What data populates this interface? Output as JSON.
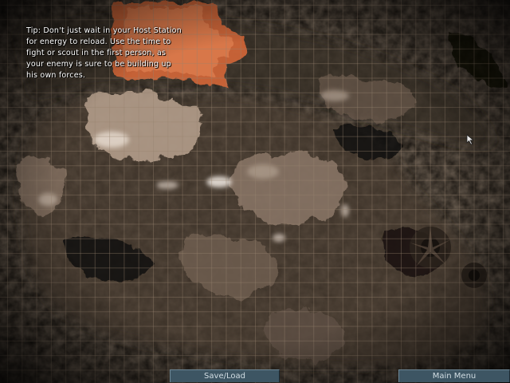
{
  "tip": {
    "lines": [
      "Tip:  Don't just wait in your Host Station",
      "for energy to reload. Use the time to",
      "fight or scout in the first person, as",
      "your enemy is sure to be building up",
      "his own forces."
    ]
  },
  "buttons": {
    "save_load": "Save/Load",
    "main_menu": "Main Menu"
  },
  "colors": {
    "button_face": "#3d5563",
    "button_text": "#d2dde3",
    "captured_sector": "#d8683a",
    "tip_text": "#ffffff"
  },
  "icons": {
    "cursor": "arrow-cursor-icon"
  }
}
